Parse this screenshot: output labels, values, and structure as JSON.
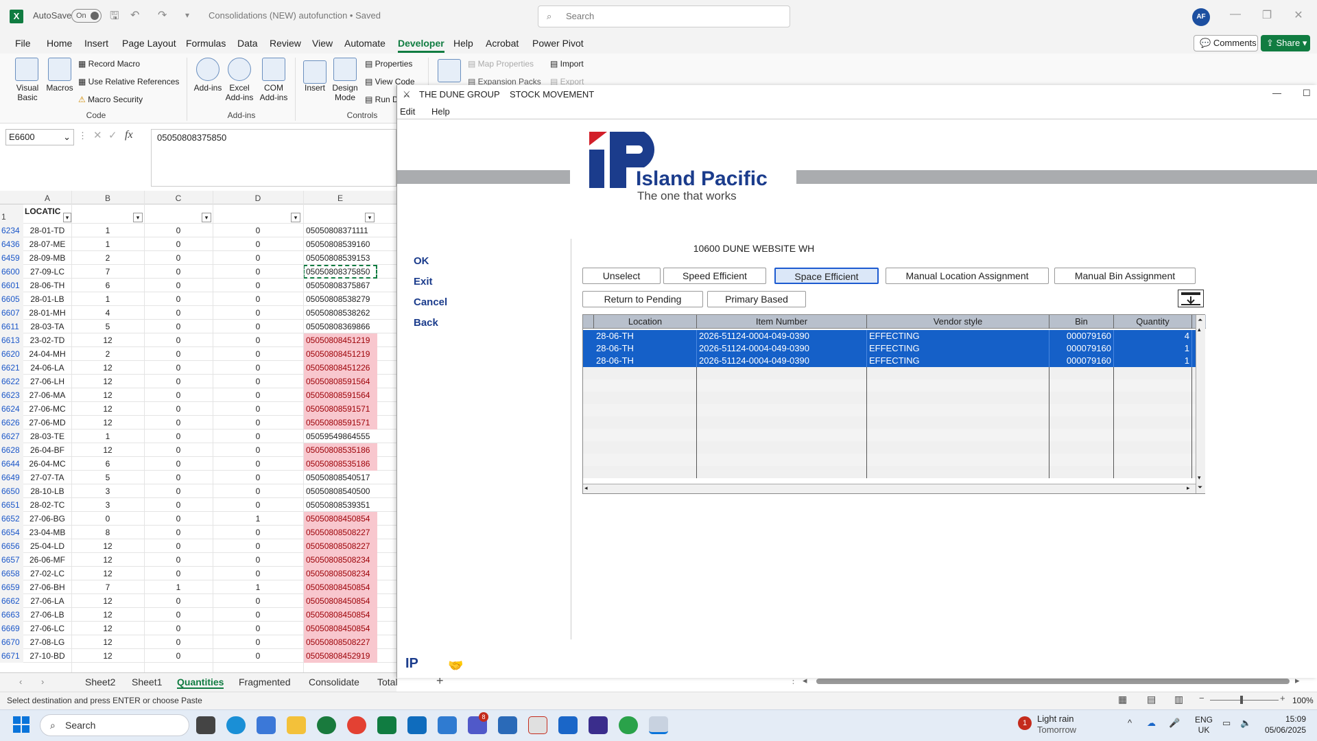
{
  "window": {
    "autosave_label": "AutoSave",
    "autosave_state": "On",
    "doc_title": "Consolidations (NEW) autofunction • Saved",
    "search_placeholder": "Search",
    "user_initials": "AF"
  },
  "menu": [
    "File",
    "Home",
    "Insert",
    "Page Layout",
    "Formulas",
    "Data",
    "Review",
    "View",
    "Automate",
    "Developer",
    "Help",
    "Acrobat",
    "Power Pivot"
  ],
  "buttons": {
    "comments": "Comments",
    "share": "Share"
  },
  "ribbon": {
    "visual_basic": "Visual Basic",
    "macros": "Macros",
    "record_macro": "Record Macro",
    "use_relative": "Use Relative References",
    "macro_security": "Macro Security",
    "group_code": "Code",
    "addins": "Add-ins",
    "excel_addins": "Excel Add-ins",
    "com_addins": "COM Add-ins",
    "group_addins": "Add-ins",
    "insert": "Insert",
    "design_mode": "Design Mode",
    "properties": "Properties",
    "view_code": "View Code",
    "run_dialog": "Run D",
    "group_controls": "Controls",
    "map_properties": "Map Properties",
    "expansion_packs": "Expansion Packs",
    "import": "Import",
    "export": "Export"
  },
  "formula": {
    "cell_ref": "E6600",
    "value": "05050808375850"
  },
  "columns": [
    "A",
    "B",
    "C",
    "D",
    "E"
  ],
  "header_row": {
    "num": "1",
    "a": "LOCATIC"
  },
  "rows": [
    {
      "n": "6234",
      "a": "28-01-TD",
      "b": "1",
      "c": "0",
      "d": "0",
      "e": "05050808371111",
      "hl": false
    },
    {
      "n": "6436",
      "a": "28-07-ME",
      "b": "1",
      "c": "0",
      "d": "0",
      "e": "05050808539160",
      "hl": false
    },
    {
      "n": "6459",
      "a": "28-09-MB",
      "b": "2",
      "c": "0",
      "d": "0",
      "e": "05050808539153",
      "hl": false
    },
    {
      "n": "6600",
      "a": "27-09-LC",
      "b": "7",
      "c": "0",
      "d": "0",
      "e": "05050808375850",
      "hl": false
    },
    {
      "n": "6601",
      "a": "28-06-TH",
      "b": "6",
      "c": "0",
      "d": "0",
      "e": "05050808375867",
      "hl": false
    },
    {
      "n": "6605",
      "a": "28-01-LB",
      "b": "1",
      "c": "0",
      "d": "0",
      "e": "05050808538279",
      "hl": false
    },
    {
      "n": "6607",
      "a": "28-01-MH",
      "b": "4",
      "c": "0",
      "d": "0",
      "e": "05050808538262",
      "hl": false
    },
    {
      "n": "6611",
      "a": "28-03-TA",
      "b": "5",
      "c": "0",
      "d": "0",
      "e": "05050808369866",
      "hl": false
    },
    {
      "n": "6613",
      "a": "23-02-TD",
      "b": "12",
      "c": "0",
      "d": "0",
      "e": "05050808451219",
      "hl": true
    },
    {
      "n": "6620",
      "a": "24-04-MH",
      "b": "2",
      "c": "0",
      "d": "0",
      "e": "05050808451219",
      "hl": true
    },
    {
      "n": "6621",
      "a": "24-06-LA",
      "b": "12",
      "c": "0",
      "d": "0",
      "e": "05050808451226",
      "hl": true
    },
    {
      "n": "6622",
      "a": "27-06-LH",
      "b": "12",
      "c": "0",
      "d": "0",
      "e": "05050808591564",
      "hl": true
    },
    {
      "n": "6623",
      "a": "27-06-MA",
      "b": "12",
      "c": "0",
      "d": "0",
      "e": "05050808591564",
      "hl": true
    },
    {
      "n": "6624",
      "a": "27-06-MC",
      "b": "12",
      "c": "0",
      "d": "0",
      "e": "05050808591571",
      "hl": true
    },
    {
      "n": "6626",
      "a": "27-06-MD",
      "b": "12",
      "c": "0",
      "d": "0",
      "e": "05050808591571",
      "hl": true
    },
    {
      "n": "6627",
      "a": "28-03-TE",
      "b": "1",
      "c": "0",
      "d": "0",
      "e": "05059549864555",
      "hl": false
    },
    {
      "n": "6628",
      "a": "26-04-BF",
      "b": "12",
      "c": "0",
      "d": "0",
      "e": "05050808535186",
      "hl": true
    },
    {
      "n": "6644",
      "a": "26-04-MC",
      "b": "6",
      "c": "0",
      "d": "0",
      "e": "05050808535186",
      "hl": true
    },
    {
      "n": "6649",
      "a": "27-07-TA",
      "b": "5",
      "c": "0",
      "d": "0",
      "e": "05050808540517",
      "hl": false
    },
    {
      "n": "6650",
      "a": "28-10-LB",
      "b": "3",
      "c": "0",
      "d": "0",
      "e": "05050808540500",
      "hl": false
    },
    {
      "n": "6651",
      "a": "28-02-TC",
      "b": "3",
      "c": "0",
      "d": "0",
      "e": "05050808539351",
      "hl": false
    },
    {
      "n": "6652",
      "a": "27-06-BG",
      "b": "0",
      "c": "0",
      "d": "1",
      "e": "05050808450854",
      "hl": true
    },
    {
      "n": "6654",
      "a": "23-04-MB",
      "b": "8",
      "c": "0",
      "d": "0",
      "e": "05050808508227",
      "hl": true
    },
    {
      "n": "6656",
      "a": "25-04-LD",
      "b": "12",
      "c": "0",
      "d": "0",
      "e": "05050808508227",
      "hl": true
    },
    {
      "n": "6657",
      "a": "26-06-MF",
      "b": "12",
      "c": "0",
      "d": "0",
      "e": "05050808508234",
      "hl": true
    },
    {
      "n": "6658",
      "a": "27-02-LC",
      "b": "12",
      "c": "0",
      "d": "0",
      "e": "05050808508234",
      "hl": true
    },
    {
      "n": "6659",
      "a": "27-06-BH",
      "b": "7",
      "c": "1",
      "d": "1",
      "e": "05050808450854",
      "hl": true
    },
    {
      "n": "6662",
      "a": "27-06-LA",
      "b": "12",
      "c": "0",
      "d": "0",
      "e": "05050808450854",
      "hl": true
    },
    {
      "n": "6663",
      "a": "27-06-LB",
      "b": "12",
      "c": "0",
      "d": "0",
      "e": "05050808450854",
      "hl": true
    },
    {
      "n": "6669",
      "a": "27-06-LC",
      "b": "12",
      "c": "0",
      "d": "0",
      "e": "05050808450854",
      "hl": true
    },
    {
      "n": "6670",
      "a": "27-08-LG",
      "b": "12",
      "c": "0",
      "d": "0",
      "e": "05050808508227",
      "hl": true
    },
    {
      "n": "6671",
      "a": "27-10-BD",
      "b": "12",
      "c": "0",
      "d": "0",
      "e": "05050808452919",
      "hl": true
    }
  ],
  "sheets": [
    "Sheet2",
    "Sheet1",
    "Quantities",
    "Fragmented",
    "Consolidate",
    "Total"
  ],
  "status": {
    "text": "Select destination and press ENTER or choose Paste",
    "zoom": "100%"
  },
  "dialog": {
    "title": "THE DUNE GROUP    STOCK MOVEMENT",
    "menu": [
      "Edit",
      "Help"
    ],
    "logo_text": "Island Pacific",
    "logo_tag": "The one that works",
    "logo_mark": "IP",
    "actions": [
      "OK",
      "Exit",
      "Cancel",
      "Back"
    ],
    "warehouse": "10600 DUNE WEBSITE WH",
    "buttons": {
      "unselect": "Unselect",
      "speed": "Speed Efficient",
      "space": "Space Efficient",
      "manual_loc": "Manual Location Assignment",
      "manual_bin": "Manual Bin Assignment",
      "return_pending": "Return to Pending",
      "primary": "Primary Based"
    },
    "grid": {
      "headers": [
        "Location",
        "Item Number",
        "Vendor style",
        "Bin",
        "Quantity"
      ],
      "rows": [
        {
          "loc": "28-06-TH",
          "item": "2026-51124-0004-049-0390",
          "vendor": "EFFECTING",
          "bin": "000079160",
          "qty": "4"
        },
        {
          "loc": "28-06-TH",
          "item": "2026-51124-0004-049-0390",
          "vendor": "EFFECTING",
          "bin": "000079160",
          "qty": "1"
        },
        {
          "loc": "28-06-TH",
          "item": "2026-51124-0004-049-0390",
          "vendor": "EFFECTING",
          "bin": "000079160",
          "qty": "1"
        }
      ]
    }
  },
  "taskbar": {
    "search": "Search",
    "weather_title": "Light rain",
    "weather_sub": "Tomorrow",
    "weather_badge": "1",
    "lang1": "ENG",
    "lang2": "UK",
    "time": "15:09",
    "date": "05/06/2025",
    "teams_badge": "8"
  }
}
